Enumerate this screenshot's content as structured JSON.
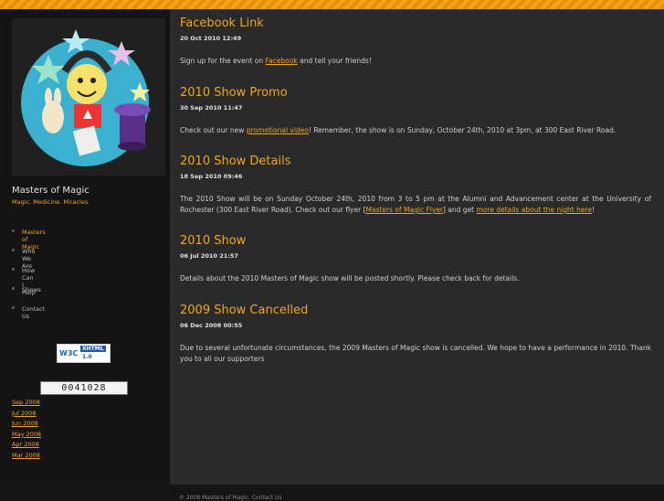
{
  "site": {
    "title": "Masters of Magic",
    "tagline": "Magic. Medicine. Miracles."
  },
  "nav": [
    {
      "label": "Masters of Magic",
      "active": true
    },
    {
      "label": "Who We Are",
      "active": false
    },
    {
      "label": "How Can I Help",
      "active": false
    },
    {
      "label": "Shows",
      "active": false
    },
    {
      "label": "Contact Us",
      "active": false
    }
  ],
  "badge": {
    "w3c": "W3C",
    "xhtml": "XHTML",
    "version": "1.0"
  },
  "counter": "0041028",
  "archives": [
    "Sep 2008",
    "Jul 2008",
    "Jun 2008",
    "May 2008",
    "Apr 2008",
    "Mar 2008"
  ],
  "posts": [
    {
      "title": "Facebook Link",
      "date": "20 Oct 2010 12:49",
      "body_before": "Sign up for the event on ",
      "link": "Facebook",
      "body_after": " and tell your friends!"
    },
    {
      "title": "2010 Show Promo",
      "date": "30 Sep 2010 11:47",
      "body_before": "Check out our new ",
      "link": "promotional video",
      "body_after": "! Remember, the show is on Sunday, October 24th, 2010 at 3pm, at 300 East River Road."
    },
    {
      "title": "2010 Show Details",
      "date": "18 Sep 2010 09:46",
      "body_before": "The 2010 Show will be on Sunday October 24th, 2010 from 3 to 5 pm at the Alumni and Advancement center at the University of Rochester (300 East River Road). Check out our flyer [",
      "link": "Masters of Magic Flyer",
      "body_mid": "] and get ",
      "link2": "more details about the night here",
      "body_after": "!"
    },
    {
      "title": "2010 Show",
      "date": "06 Jul 2010 21:57",
      "body": "Details about the 2010 Masters of Magic show will be posted shortly. Please check back for details."
    },
    {
      "title": "2009 Show Cancelled",
      "date": "06 Dec 2008 00:55",
      "body": "Due to several unfortunate circumstances, the 2009 Masters of Magic show is cancelled. We hope to have a performance in 2010. Thank you to all our supporters"
    }
  ],
  "footer": "© 2008 Masters of Magic. Contact Us"
}
